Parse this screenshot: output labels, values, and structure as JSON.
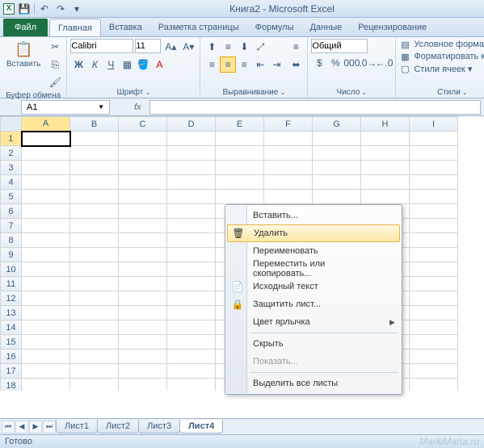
{
  "title": "Книга2 - Microsoft Excel",
  "qat": {
    "save": "💾",
    "undo": "↶",
    "redo": "↷"
  },
  "tabs": {
    "file": "Файл",
    "items": [
      "Главная",
      "Вставка",
      "Разметка страницы",
      "Формулы",
      "Данные",
      "Рецензирование"
    ],
    "active": 0
  },
  "ribbon": {
    "clipboard": {
      "label": "Буфер обмена",
      "paste": "Вставить",
      "paste_icon": "📋"
    },
    "font": {
      "label": "Шрифт",
      "name": "Calibri",
      "size": "11",
      "bold": "Ж",
      "italic": "К",
      "underline": "Ч"
    },
    "align": {
      "label": "Выравнивание",
      "wrap": "≡",
      "merge": "⬌"
    },
    "number": {
      "label": "Число",
      "format": "Общий"
    },
    "styles": {
      "label": "Стили",
      "cond": "Условное форматиро",
      "fmt_table": "Форматировать как та",
      "cell_styles": "Стили ячеек ▾"
    }
  },
  "namebox": "A1",
  "fx_label": "fx",
  "columns": [
    "A",
    "B",
    "C",
    "D",
    "E",
    "F",
    "G",
    "H",
    "I"
  ],
  "rows": [
    "1",
    "2",
    "3",
    "4",
    "5",
    "6",
    "7",
    "8",
    "9",
    "10",
    "11",
    "12",
    "13",
    "14",
    "15",
    "16",
    "17",
    "18"
  ],
  "active_cell": "A1",
  "context_menu": {
    "insert": "Вставить...",
    "delete": "Удалить",
    "rename": "Переименовать",
    "move_copy": "Переместить или скопировать...",
    "view_code": "Исходный текст",
    "protect": "Защитить лист...",
    "tab_color": "Цвет ярлычка",
    "hide": "Скрыть",
    "unhide": "Показать...",
    "select_all": "Выделить все листы"
  },
  "sheets": [
    "Лист1",
    "Лист2",
    "Лист3",
    "Лист4"
  ],
  "sheet_active": 3,
  "status": "Готово",
  "watermark": "MarkiMarta.ru"
}
